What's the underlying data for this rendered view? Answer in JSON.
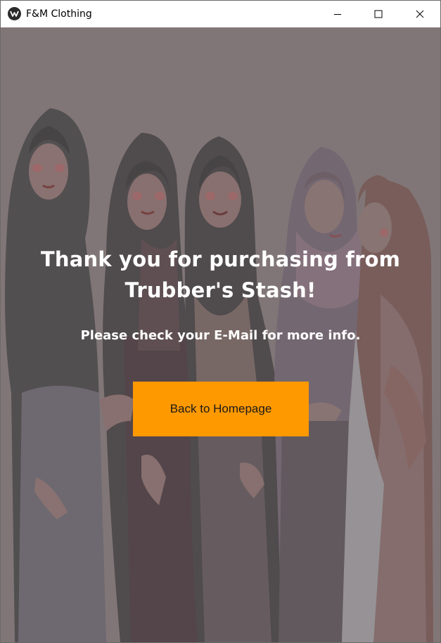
{
  "window": {
    "title": "F&M Clothing",
    "app_icon": "app-logo-icon",
    "controls": [
      "minimize-icon",
      "maximize-icon",
      "close-icon"
    ]
  },
  "page": {
    "heading": "Thank you for purchasing from Trubber's Stash!",
    "message": "Please check your E-Mail for more info.",
    "button_label": "Back to Homepage"
  },
  "colors": {
    "background": "#857b7b",
    "button": "#ff9900",
    "text": "#ffffff"
  }
}
